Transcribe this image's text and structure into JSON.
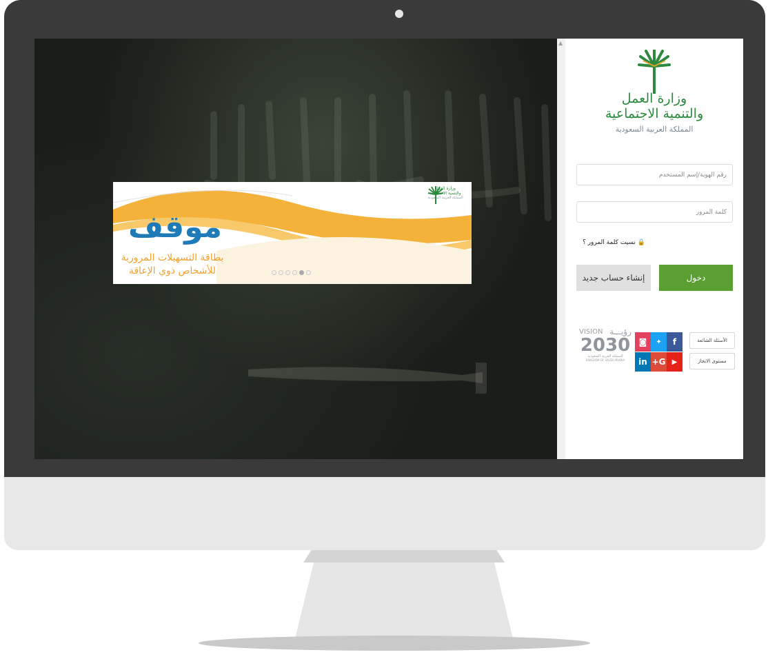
{
  "login": {
    "logo": {
      "line1": "وزارة العمل",
      "line2": "والتنمية الاجتماعية",
      "line3": "المملكة العربية السعودية"
    },
    "username_placeholder": "رقم الهوية/إسم المستخدم",
    "password_placeholder": "كلمة المرور",
    "forgot_password": "نسيت كلمة المرور ؟",
    "login_button": "دخول",
    "register_button": "إنشاء حساب جديد",
    "links": [
      "الأسئلة الشائعة",
      "مستوى الانجاز"
    ],
    "social": [
      {
        "icon": "facebook-icon",
        "glyph": "f",
        "color": "#3b5998"
      },
      {
        "icon": "twitter-icon",
        "glyph": "🐦",
        "color": "#1da1f2"
      },
      {
        "icon": "instagram-icon",
        "glyph": "◙",
        "color": "#e4405f"
      },
      {
        "icon": "youtube-icon",
        "glyph": "▶",
        "color": "#e62117"
      },
      {
        "icon": "google-plus-icon",
        "glyph": "G+",
        "color": "#dd4b39"
      },
      {
        "icon": "linkedin-icon",
        "glyph": "in",
        "color": "#0077b5"
      }
    ],
    "vision": {
      "vision_text": "VISION",
      "arabic": "رؤيـــة",
      "year": "2030",
      "country_ar": "المملكة العربية السعودية",
      "country_en": "KINGDOM OF SAUDI ARABIA"
    }
  },
  "banner": {
    "title": "موقف",
    "subtitle1": "بطاقة التسهيلات المرورية",
    "subtitle2": "للأشخاص ذوي الإعاقة",
    "logo_line1": "وزارة العمل",
    "logo_line2": "والتنمية الاجتماعية",
    "logo_line3": "المملكة العربية السعودية",
    "slides_total": 6,
    "slide_active": 5
  },
  "colors": {
    "accent_green": "#5b9f33",
    "logo_green": "#2b8a3e",
    "banner_orange": "#f2a12f",
    "banner_blue": "#1f7ab8"
  }
}
